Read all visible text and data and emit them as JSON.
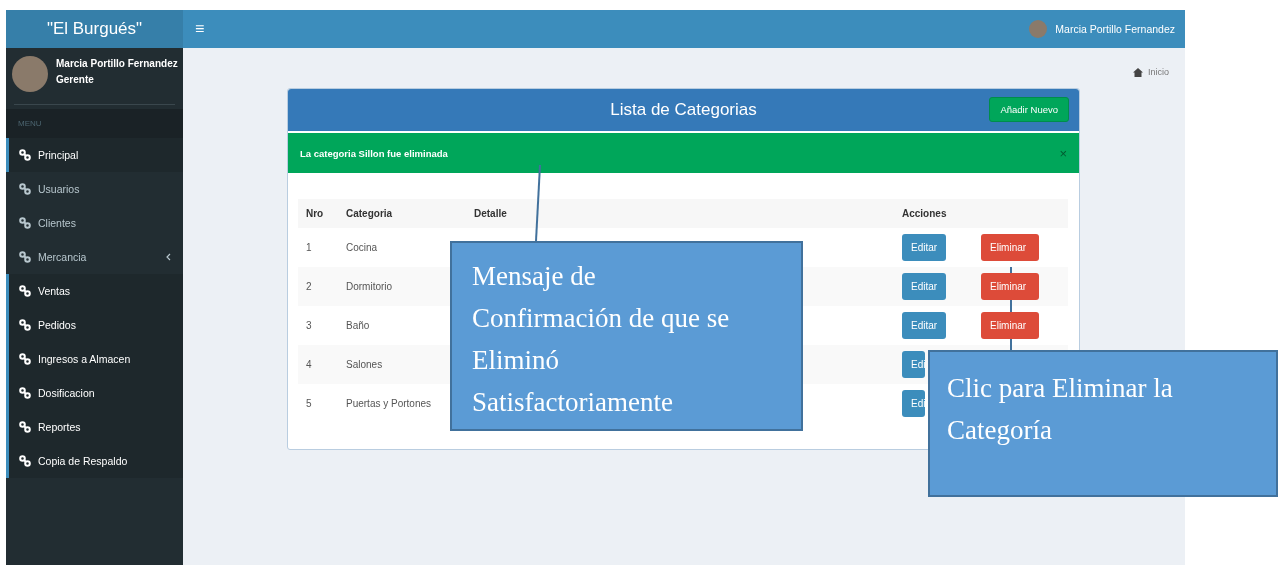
{
  "header": {
    "brand": "\"El Burgués\"",
    "menu_toggle": "≡",
    "user_name": "Marcia Portillo Fernandez"
  },
  "sidebar": {
    "user": {
      "name": "Marcia Portillo Fernandez",
      "role": "Gerente"
    },
    "section": "MENU",
    "items": [
      {
        "label": "Principal",
        "active": true,
        "submenu": false
      },
      {
        "label": "Usuarios",
        "active": false,
        "submenu": false
      },
      {
        "label": "Clientes",
        "active": false,
        "submenu": false
      },
      {
        "label": "Mercancia",
        "active": false,
        "submenu": true
      },
      {
        "label": "Ventas",
        "active": true,
        "submenu": false
      },
      {
        "label": "Pedidos",
        "active": true,
        "submenu": false
      },
      {
        "label": "Ingresos a Almacen",
        "active": true,
        "submenu": false
      },
      {
        "label": "Dosificacion",
        "active": true,
        "submenu": false
      },
      {
        "label": "Reportes",
        "active": true,
        "submenu": false
      },
      {
        "label": "Copia de Respaldo",
        "active": true,
        "submenu": false
      }
    ]
  },
  "breadcrumb": [
    "Inicio"
  ],
  "card": {
    "title": "Lista de Categorias",
    "add_button": "Añadir Nuevo",
    "alert": {
      "text": "La categoria Sillon fue eliminada",
      "close": "×"
    },
    "table": {
      "columns": [
        "Nro",
        "Categoria",
        "Detalle",
        "Acciones"
      ],
      "rows": [
        {
          "nro": "1",
          "categoria": "Cocina",
          "edit": "Editar",
          "delete": "Eliminar"
        },
        {
          "nro": "2",
          "categoria": "Dormitorio",
          "edit": "Editar",
          "delete": "Eliminar"
        },
        {
          "nro": "3",
          "categoria": "Baño",
          "edit": "Editar",
          "delete": "Eliminar"
        },
        {
          "nro": "4",
          "categoria": "Salones",
          "edit": "Edi"
        },
        {
          "nro": "5",
          "categoria": "Puertas y Portones",
          "edit": "Edi"
        }
      ]
    }
  },
  "annotations": [
    {
      "lines": [
        "Mensaje de",
        "Confirmación de que se",
        "Eliminó",
        "Satisfactoriamente"
      ]
    },
    {
      "lines": [
        "Clic para Eliminar la",
        "Categoría"
      ]
    }
  ]
}
